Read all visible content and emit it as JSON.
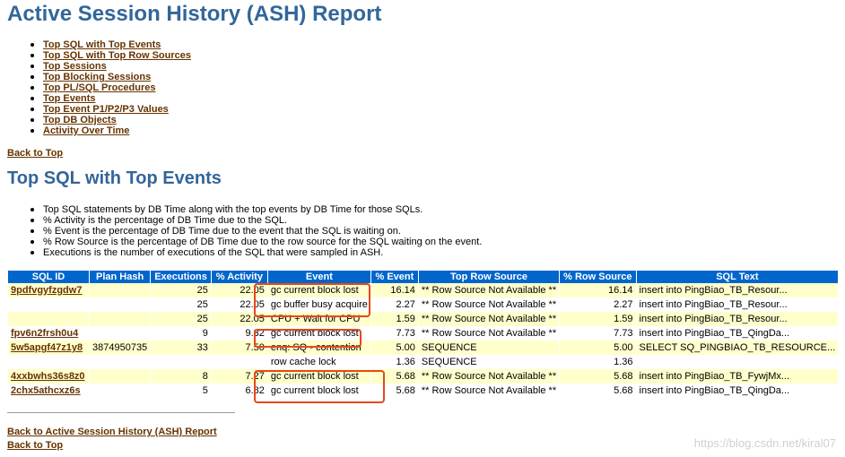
{
  "title": "Active Session History (ASH) Report",
  "toc": [
    "Top SQL with Top Events",
    "Top SQL with Top Row Sources",
    "Top Sessions",
    "Top Blocking Sessions",
    "Top PL/SQL Procedures",
    "Top Events",
    "Top Event P1/P2/P3 Values",
    "Top DB Objects",
    "Activity Over Time"
  ],
  "back_to_top": "Back to Top",
  "section_title": "Top SQL with Top Events",
  "notes": [
    "Top SQL statements by DB Time along with the top events by DB Time for those SQLs.",
    "% Activity is the percentage of DB Time due to the SQL.",
    "% Event is the percentage of DB Time due to the event that the SQL is waiting on.",
    "% Row Source is the percentage of DB Time due to the row source for the SQL waiting on the event.",
    "Executions is the number of executions of the SQL that were sampled in ASH."
  ],
  "table": {
    "headers": [
      "SQL ID",
      "Plan Hash",
      "Executions",
      "% Activity",
      "Event",
      "% Event",
      "Top Row Source",
      "% Row Source",
      "SQL Text"
    ],
    "rows": [
      [
        "9pdfvgyfzgdw7",
        "",
        "25",
        "22.05",
        "gc current block lost",
        "16.14",
        "** Row Source Not Available **",
        "16.14",
        "insert into PingBiao_TB_Resour..."
      ],
      [
        "",
        "",
        "25",
        "22.05",
        "gc buffer busy acquire",
        "2.27",
        "** Row Source Not Available **",
        "2.27",
        "insert into PingBiao_TB_Resour..."
      ],
      [
        "",
        "",
        "25",
        "22.05",
        "CPU + Wait for CPU",
        "1.59",
        "** Row Source Not Available **",
        "1.59",
        "insert into PingBiao_TB_Resour..."
      ],
      [
        "fpv6n2frsh0u4",
        "",
        "9",
        "9.32",
        "gc current block lost",
        "7.73",
        "** Row Source Not Available **",
        "7.73",
        "insert into PingBiao_TB_QingDa..."
      ],
      [
        "5w5apgf47z1y8",
        "3874950735",
        "33",
        "7.50",
        "enq: SQ - contention",
        "5.00",
        "SEQUENCE",
        "5.00",
        "SELECT SQ_PINGBIAO_TB_RESOURCE..."
      ],
      [
        "",
        "",
        "",
        "",
        "row cache lock",
        "1.36",
        "SEQUENCE",
        "1.36",
        ""
      ],
      [
        "4xxbwhs36s8z0",
        "",
        "8",
        "7.27",
        "gc current block lost",
        "5.68",
        "** Row Source Not Available **",
        "5.68",
        "insert into PingBiao_TB_FywjMx..."
      ],
      [
        "2chx5athcxz6s",
        "",
        "5",
        "6.82",
        "gc current block lost",
        "5.68",
        "** Row Source Not Available **",
        "5.68",
        "insert into PingBiao_TB_QingDa..."
      ]
    ]
  },
  "back_to_ash": "Back to Active Session History (ASH) Report",
  "back_to_top_2": "Back to Top",
  "watermark": "https://blog.csdn.net/kiral07",
  "colors": {
    "heading": "#336699",
    "link": "#663300",
    "header_bg": "#0066cc",
    "odd_row": "#ffffcc",
    "highlight": "#e8471c"
  }
}
